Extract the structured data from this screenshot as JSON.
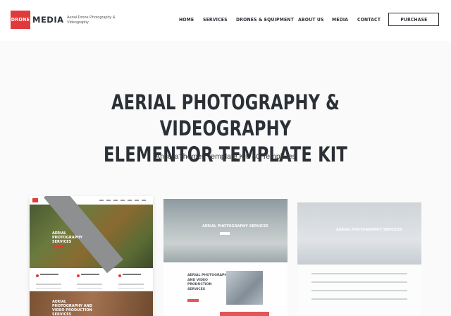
{
  "header": {
    "logo_box": "DRONE",
    "logo_text": "MEDIA",
    "tagline": "Aerial Drone Photography & Videography",
    "nav": [
      "HOME",
      "SERVICES",
      "DRONES & EQUIPMENT",
      "ABOUT US",
      "MEDIA",
      "CONTACT"
    ],
    "purchase_label": "PURCHASE"
  },
  "hero": {
    "title_line1": "AERIAL PHOTOGRAPHY & VIDEOGRAPHY",
    "title_line2": "ELEMENTOR TEMPLATE KIT",
    "subtitle": "AncoraThemes Template Kit: 40 Templates"
  },
  "previews": [
    {
      "title": "AERIAL PHOTOGRAPHY SERVICES",
      "title2": "AERIAL PHOTOGRAPHY AND VIDEO PRODUCTION SERVICES"
    },
    {
      "title": "AERIAL PHOTOGRAPHY SERVICES",
      "body_title": "AERIAL PHOTOGRAPHY AND VIDEO PRODUCTION SERVICES"
    },
    {
      "title": "AERIAL PHOTOGRAPHY SERVICES"
    }
  ],
  "colors": {
    "accent": "#e03a3a",
    "text": "#2b3036"
  }
}
